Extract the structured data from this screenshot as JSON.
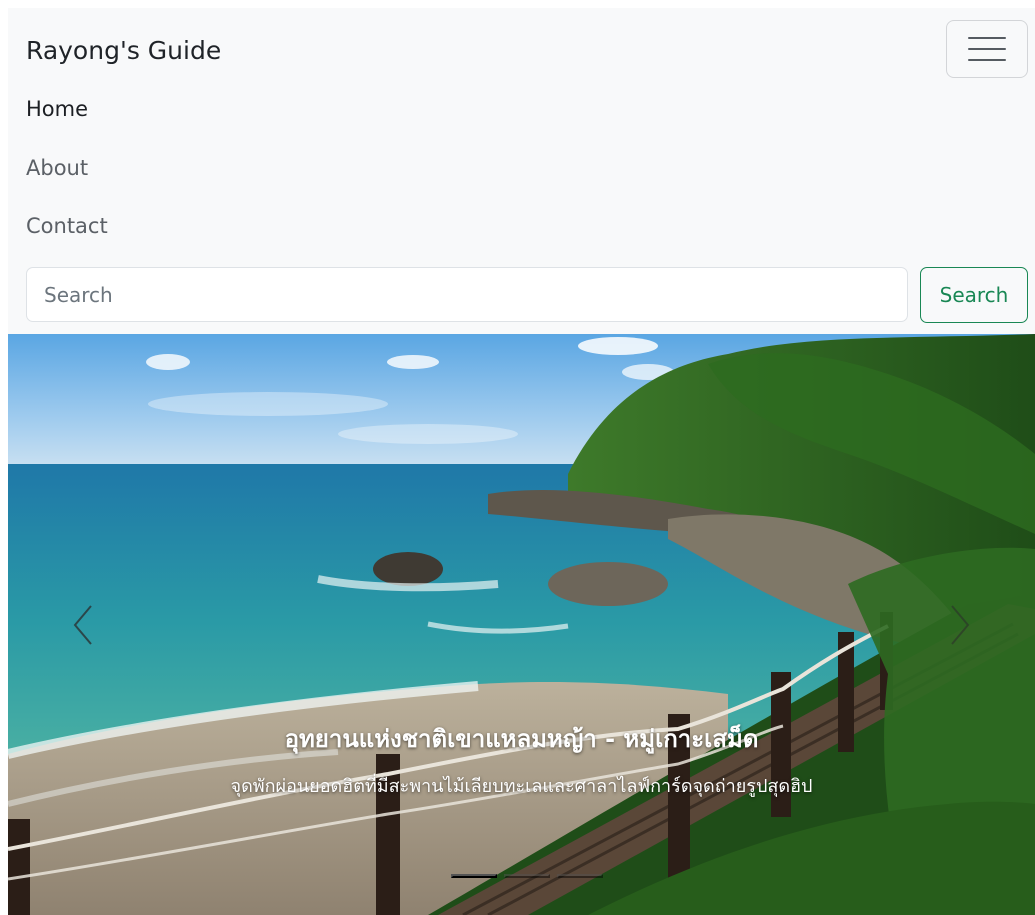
{
  "navbar": {
    "brand": "Rayong's Guide",
    "toggler_icon": "hamburger-menu-icon",
    "links": [
      {
        "label": "Home",
        "active": true
      },
      {
        "label": "About",
        "active": false
      },
      {
        "label": "Contact",
        "active": false
      }
    ],
    "search": {
      "placeholder": "Search",
      "button_label": "Search"
    }
  },
  "carousel": {
    "slides": [
      {
        "title": "อุทยานแห่งชาติเขาแหลมหญ้า - หมู่เกาะเสม็ด",
        "text": "จุดพักผ่อนยอดฮิตที่มีสะพานไม้เลียบทะเลและศาลาไลฟ์การ์ดจุดถ่ายรูปสุดฮิป"
      }
    ],
    "active_index": 0,
    "prev_icon": "chevron-left-icon",
    "next_icon": "chevron-right-icon",
    "indicator_count": 3
  },
  "colors": {
    "navbar_bg": "#f8f9fa",
    "success": "#198754",
    "caption_text": "#ffffff"
  }
}
